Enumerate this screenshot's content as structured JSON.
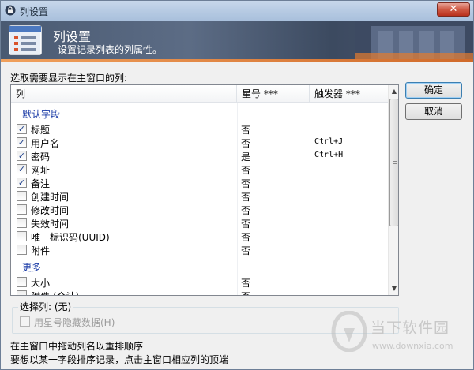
{
  "window": {
    "title": "列设置",
    "close_label": "✕"
  },
  "banner": {
    "title": "列设置",
    "subtitle": "设置记录列表的列属性。"
  },
  "instruction": "选取需要显示在主窗口的列:",
  "list": {
    "headers": {
      "column": "列",
      "star": "星号 ***",
      "trigger": "触发器 ***"
    },
    "groups": [
      {
        "label": "默认字段",
        "rows": [
          {
            "checked": true,
            "name": "标题",
            "star": "否",
            "trigger": ""
          },
          {
            "checked": true,
            "name": "用户名",
            "star": "否",
            "trigger": "Ctrl+J"
          },
          {
            "checked": true,
            "name": "密码",
            "star": "是",
            "trigger": "Ctrl+H"
          },
          {
            "checked": true,
            "name": "网址",
            "star": "否",
            "trigger": ""
          },
          {
            "checked": true,
            "name": "备注",
            "star": "否",
            "trigger": ""
          },
          {
            "checked": false,
            "name": "创建时间",
            "star": "否",
            "trigger": ""
          },
          {
            "checked": false,
            "name": "修改时间",
            "star": "否",
            "trigger": ""
          },
          {
            "checked": false,
            "name": "失效时间",
            "star": "否",
            "trigger": ""
          },
          {
            "checked": false,
            "name": "唯一标识码(UUID)",
            "star": "否",
            "trigger": ""
          },
          {
            "checked": false,
            "name": "附件",
            "star": "否",
            "trigger": ""
          }
        ]
      },
      {
        "label": "更多",
        "rows": [
          {
            "checked": false,
            "name": "大小",
            "star": "否",
            "trigger": ""
          },
          {
            "checked": false,
            "name": "附件 (合计)",
            "star": "否",
            "trigger": ""
          }
        ]
      }
    ],
    "check_mark": "✓"
  },
  "buttons": {
    "ok": "确定",
    "cancel": "取消"
  },
  "selected": {
    "label": "选择列: (无)",
    "hide_label": "用星号隐藏数据(H)"
  },
  "footer": {
    "line1": "在主窗口中拖动列名以重排顺序",
    "line2": "要想以某一字段排序记录，点击主窗口相应列的顶端"
  },
  "watermark": {
    "text": "当下软件园",
    "url": "www.downxia.com"
  },
  "colors": {
    "group": "#1e3ea8",
    "banner": "#4a5a72",
    "accent": "#d06a2a"
  }
}
